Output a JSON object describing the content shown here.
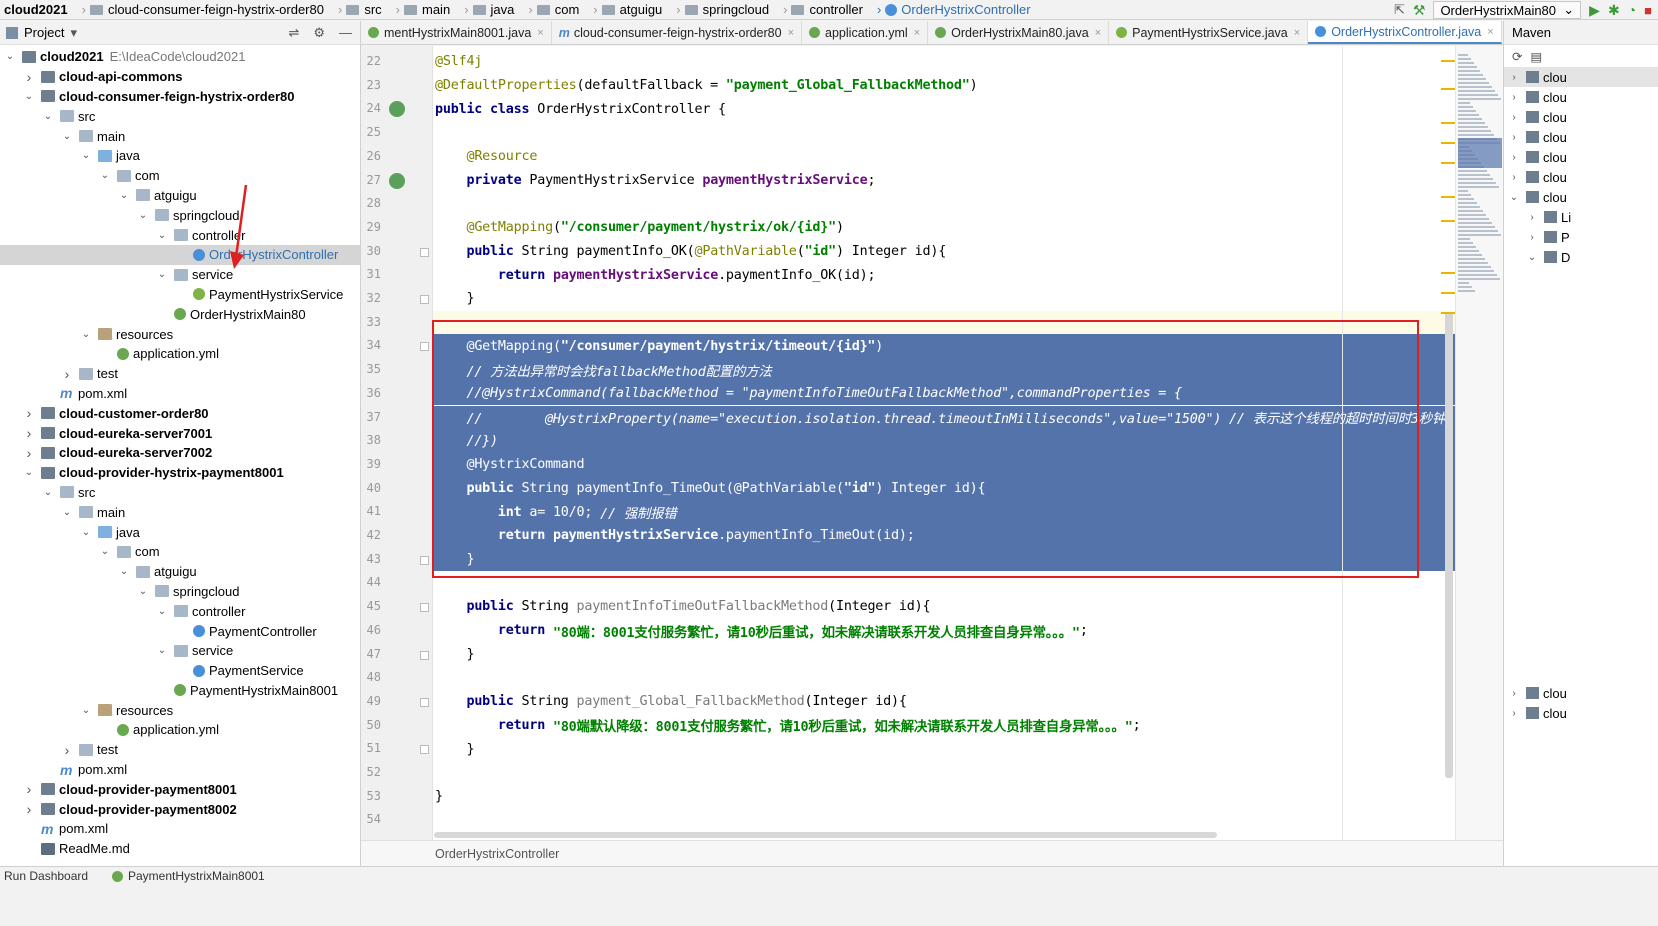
{
  "breadcrumb": [
    "cloud2021",
    "cloud-consumer-feign-hystrix-order80",
    "src",
    "main",
    "java",
    "com",
    "atguigu",
    "springcloud",
    "controller",
    "OrderHystrixController"
  ],
  "run_config": "OrderHystrixMain80",
  "project_panel": {
    "title": "Project",
    "tree": [
      {
        "indent": 0,
        "arrow": "v",
        "icon": "mod",
        "label": "cloud2021",
        "bold": true,
        "path": "E:\\IdeaCode\\cloud2021"
      },
      {
        "indent": 1,
        "arrow": ">",
        "icon": "mod",
        "label": "cloud-api-commons",
        "bold": true
      },
      {
        "indent": 1,
        "arrow": "v",
        "icon": "mod",
        "label": "cloud-consumer-feign-hystrix-order80",
        "bold": true
      },
      {
        "indent": 2,
        "arrow": "v",
        "icon": "fold",
        "label": "src"
      },
      {
        "indent": 3,
        "arrow": "v",
        "icon": "fold",
        "label": "main"
      },
      {
        "indent": 4,
        "arrow": "v",
        "icon": "jfold",
        "label": "java"
      },
      {
        "indent": 5,
        "arrow": "v",
        "icon": "fold",
        "label": "com"
      },
      {
        "indent": 6,
        "arrow": "v",
        "icon": "fold",
        "label": "atguigu"
      },
      {
        "indent": 7,
        "arrow": "v",
        "icon": "fold",
        "label": "springcloud"
      },
      {
        "indent": 8,
        "arrow": "v",
        "icon": "fold",
        "label": "controller"
      },
      {
        "indent": 9,
        "arrow": "",
        "icon": "cls",
        "label": "OrderHystrixController",
        "selected": true
      },
      {
        "indent": 8,
        "arrow": "v",
        "icon": "fold",
        "label": "service"
      },
      {
        "indent": 9,
        "arrow": "",
        "icon": "intf",
        "label": "PaymentHystrixService"
      },
      {
        "indent": 8,
        "arrow": "",
        "icon": "spring",
        "label": "OrderHystrixMain80"
      },
      {
        "indent": 4,
        "arrow": "v",
        "icon": "res",
        "label": "resources"
      },
      {
        "indent": 5,
        "arrow": "",
        "icon": "spring",
        "label": "application.yml"
      },
      {
        "indent": 3,
        "arrow": ">",
        "icon": "fold",
        "label": "test"
      },
      {
        "indent": 2,
        "arrow": "",
        "icon": "m",
        "label": "pom.xml"
      },
      {
        "indent": 1,
        "arrow": ">",
        "icon": "mod",
        "label": "cloud-customer-order80",
        "bold": true
      },
      {
        "indent": 1,
        "arrow": ">",
        "icon": "mod",
        "label": "cloud-eureka-server7001",
        "bold": true
      },
      {
        "indent": 1,
        "arrow": ">",
        "icon": "mod",
        "label": "cloud-eureka-server7002",
        "bold": true
      },
      {
        "indent": 1,
        "arrow": "v",
        "icon": "mod",
        "label": "cloud-provider-hystrix-payment8001",
        "bold": true
      },
      {
        "indent": 2,
        "arrow": "v",
        "icon": "fold",
        "label": "src"
      },
      {
        "indent": 3,
        "arrow": "v",
        "icon": "fold",
        "label": "main"
      },
      {
        "indent": 4,
        "arrow": "v",
        "icon": "jfold",
        "label": "java"
      },
      {
        "indent": 5,
        "arrow": "v",
        "icon": "fold",
        "label": "com"
      },
      {
        "indent": 6,
        "arrow": "v",
        "icon": "fold",
        "label": "atguigu"
      },
      {
        "indent": 7,
        "arrow": "v",
        "icon": "fold",
        "label": "springcloud"
      },
      {
        "indent": 8,
        "arrow": "v",
        "icon": "fold",
        "label": "controller"
      },
      {
        "indent": 9,
        "arrow": "",
        "icon": "cls",
        "label": "PaymentController"
      },
      {
        "indent": 8,
        "arrow": "v",
        "icon": "fold",
        "label": "service"
      },
      {
        "indent": 9,
        "arrow": "",
        "icon": "cls",
        "label": "PaymentService"
      },
      {
        "indent": 8,
        "arrow": "",
        "icon": "spring",
        "label": "PaymentHystrixMain8001"
      },
      {
        "indent": 4,
        "arrow": "v",
        "icon": "res",
        "label": "resources"
      },
      {
        "indent": 5,
        "arrow": "",
        "icon": "spring",
        "label": "application.yml"
      },
      {
        "indent": 3,
        "arrow": ">",
        "icon": "fold",
        "label": "test"
      },
      {
        "indent": 2,
        "arrow": "",
        "icon": "m",
        "label": "pom.xml"
      },
      {
        "indent": 1,
        "arrow": ">",
        "icon": "mod",
        "label": "cloud-provider-payment8001",
        "bold": true
      },
      {
        "indent": 1,
        "arrow": ">",
        "icon": "mod",
        "label": "cloud-provider-payment8002",
        "bold": true
      },
      {
        "indent": 1,
        "arrow": "",
        "icon": "m",
        "label": "pom.xml"
      },
      {
        "indent": 1,
        "arrow": "",
        "icon": "md",
        "label": "ReadMe.md"
      }
    ]
  },
  "tabs": [
    {
      "label": "mentHystrixMain8001.java",
      "icon": "#6aa84f"
    },
    {
      "label": "cloud-consumer-feign-hystrix-order80",
      "icon": "m"
    },
    {
      "label": "application.yml",
      "icon": "#6aa84f"
    },
    {
      "label": "OrderHystrixMain80.java",
      "icon": "#6aa84f"
    },
    {
      "label": "PaymentHystrixService.java",
      "icon": "#7fb348"
    },
    {
      "label": "OrderHystrixController.java",
      "icon": "#4a90d9",
      "active": true
    }
  ],
  "tabs_overflow": "≡4",
  "editor": {
    "file_crumb": "OrderHystrixController",
    "lines": [
      {
        "n": "22",
        "t": [
          [
            "ann",
            "@Slf4j"
          ]
        ]
      },
      {
        "n": "23",
        "t": [
          [
            "ann",
            "@DefaultProperties"
          ],
          [
            "",
            "(defaultFallback = "
          ],
          [
            "str",
            "\"payment_Global_FallbackMethod\""
          ],
          [
            "",
            ")"
          ]
        ]
      },
      {
        "n": "24",
        "t": [
          [
            "kw",
            "public class "
          ],
          [
            "",
            "OrderHystrixController {"
          ]
        ]
      },
      {
        "n": "25",
        "t": []
      },
      {
        "n": "26",
        "t": [
          [
            "",
            "    "
          ],
          [
            "ann",
            "@Resource"
          ]
        ]
      },
      {
        "n": "27",
        "t": [
          [
            "",
            "    "
          ],
          [
            "kw",
            "private "
          ],
          [
            "",
            "PaymentHystrixService "
          ],
          [
            "fld",
            "paymentHystrixService"
          ],
          [
            "",
            ";"
          ]
        ]
      },
      {
        "n": "28",
        "t": []
      },
      {
        "n": "29",
        "t": [
          [
            "",
            "    "
          ],
          [
            "ann",
            "@GetMapping"
          ],
          [
            "",
            "("
          ],
          [
            "str",
            "\"/consumer/payment/hystrix/ok/{id}\""
          ],
          [
            "",
            ")"
          ]
        ]
      },
      {
        "n": "30",
        "t": [
          [
            "",
            "    "
          ],
          [
            "kw",
            "public "
          ],
          [
            "",
            "String paymentInfo_OK("
          ],
          [
            "ann",
            "@PathVariable"
          ],
          [
            "",
            "("
          ],
          [
            "str",
            "\"id\""
          ],
          [
            "",
            ") Integer id){"
          ]
        ]
      },
      {
        "n": "31",
        "t": [
          [
            "",
            "        "
          ],
          [
            "kw",
            "return "
          ],
          [
            "fld",
            "paymentHystrixService"
          ],
          [
            "",
            ".paymentInfo_OK(id);"
          ]
        ]
      },
      {
        "n": "32",
        "t": [
          [
            "",
            "    }"
          ]
        ]
      },
      {
        "n": "33",
        "t": [],
        "cur": true
      },
      {
        "n": "34",
        "t": [
          [
            "",
            "    "
          ],
          [
            "ann",
            "@GetMapping"
          ],
          [
            "",
            "("
          ],
          [
            "str",
            "\"/consumer/payment/hystrix/timeout/{id}\""
          ],
          [
            "",
            ")"
          ]
        ],
        "hl": true
      },
      {
        "n": "35",
        "t": [
          [
            "",
            "    "
          ],
          [
            "cmt",
            "// 方法出异常时会找fallbackMethod配置的方法"
          ]
        ],
        "hl": true
      },
      {
        "n": "36",
        "t": [
          [
            "",
            "    "
          ],
          [
            "cmt",
            "//@HystrixCommand(fallbackMethod = \"paymentInfoTimeOutFallbackMethod\",commandProperties = {"
          ]
        ],
        "hl": true
      },
      {
        "n": "37",
        "t": [
          [
            "",
            "    "
          ],
          [
            "cmt",
            "//        @HystrixProperty(name=\"execution.isolation.thread.timeoutInMilliseconds\",value=\"1500\") // 表示这个线程的超时时间时3秒钟,"
          ]
        ],
        "hl": true
      },
      {
        "n": "38",
        "t": [
          [
            "",
            "    "
          ],
          [
            "cmt",
            "//})"
          ]
        ],
        "hl": true
      },
      {
        "n": "39",
        "t": [
          [
            "",
            "    "
          ],
          [
            "ann",
            "@HystrixCommand"
          ]
        ],
        "hl": true
      },
      {
        "n": "40",
        "t": [
          [
            "",
            "    "
          ],
          [
            "kw",
            "public "
          ],
          [
            "",
            "String paymentInfo_TimeOut("
          ],
          [
            "ann",
            "@PathVariable"
          ],
          [
            "",
            "("
          ],
          [
            "str",
            "\"id\""
          ],
          [
            "",
            ") Integer id){"
          ]
        ],
        "hl": true
      },
      {
        "n": "41",
        "t": [
          [
            "",
            "        "
          ],
          [
            "kw",
            "int "
          ],
          [
            "",
            "a= 10/0; "
          ],
          [
            "cmt",
            "// 强制报错"
          ]
        ],
        "hl": true
      },
      {
        "n": "42",
        "t": [
          [
            "",
            "        "
          ],
          [
            "kw",
            "return "
          ],
          [
            "fld",
            "paymentHystrixService"
          ],
          [
            "",
            ".paymentInfo_TimeOut(id);"
          ]
        ],
        "hl": true
      },
      {
        "n": "43",
        "t": [
          [
            "",
            "    }"
          ]
        ],
        "hl": true
      },
      {
        "n": "44",
        "t": []
      },
      {
        "n": "45",
        "t": [
          [
            "",
            "    "
          ],
          [
            "kw",
            "public "
          ],
          [
            "",
            "String "
          ],
          [
            "mth",
            "paymentInfoTimeOutFallbackMethod"
          ],
          [
            "",
            "(Integer id){"
          ]
        ]
      },
      {
        "n": "46",
        "t": [
          [
            "",
            "        "
          ],
          [
            "kw",
            "return "
          ],
          [
            "str",
            "\"80端：8001支付服务繁忙，请10秒后重试，如未解决请联系开发人员排查自身异常。。。\""
          ],
          [
            "",
            ";"
          ]
        ]
      },
      {
        "n": "47",
        "t": [
          [
            "",
            "    }"
          ]
        ]
      },
      {
        "n": "48",
        "t": []
      },
      {
        "n": "49",
        "t": [
          [
            "",
            "    "
          ],
          [
            "kw",
            "public "
          ],
          [
            "",
            "String "
          ],
          [
            "mth",
            "payment_Global_FallbackMethod"
          ],
          [
            "",
            "(Integer id){"
          ]
        ]
      },
      {
        "n": "50",
        "t": [
          [
            "",
            "        "
          ],
          [
            "kw",
            "return "
          ],
          [
            "str",
            "\"80端默认降级：8001支付服务繁忙，请10秒后重试，如未解决请联系开发人员排查自身异常。。。\""
          ],
          [
            "",
            ";"
          ]
        ]
      },
      {
        "n": "51",
        "t": [
          [
            "",
            "    }"
          ]
        ]
      },
      {
        "n": "52",
        "t": []
      },
      {
        "n": "53",
        "t": [
          [
            "",
            "}"
          ]
        ]
      },
      {
        "n": "54",
        "t": []
      }
    ]
  },
  "maven_panel": {
    "title": "Maven",
    "rows": [
      {
        "indent": 0,
        "arrow": ">",
        "label": "clou",
        "hl": true
      },
      {
        "indent": 0,
        "arrow": ">",
        "label": "clou"
      },
      {
        "indent": 0,
        "arrow": ">",
        "label": "clou"
      },
      {
        "indent": 0,
        "arrow": ">",
        "label": "clou"
      },
      {
        "indent": 0,
        "arrow": ">",
        "label": "clou"
      },
      {
        "indent": 0,
        "arrow": ">",
        "label": "clou"
      },
      {
        "indent": 0,
        "arrow": "v",
        "label": "clou"
      },
      {
        "indent": 1,
        "arrow": ">",
        "label": "Li"
      },
      {
        "indent": 1,
        "arrow": ">",
        "label": "P"
      },
      {
        "indent": 1,
        "arrow": "v",
        "label": "D"
      }
    ],
    "bottom_rows": [
      {
        "arrow": ">",
        "label": "clou"
      },
      {
        "arrow": ">",
        "label": "clou"
      }
    ]
  },
  "bottom_tabs": [
    "Run Dashboard",
    "PaymentHystrixMain8001"
  ],
  "colors": {
    "selection": "#5573ab",
    "annotation_box": "#e02020",
    "arrow": "#e02020"
  }
}
